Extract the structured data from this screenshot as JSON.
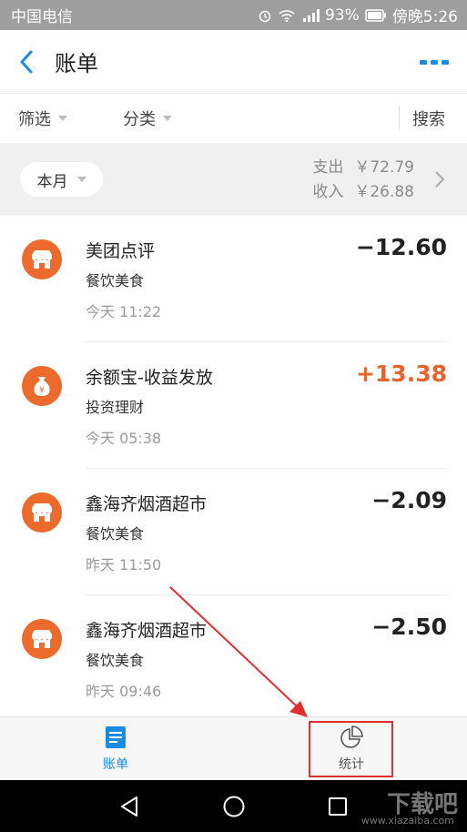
{
  "status_bar": {
    "carrier": "中国电信",
    "battery": "93%",
    "time": "傍晚5:26",
    "icons": [
      "alarm-icon",
      "wifi-icon",
      "signal-icon",
      "battery-icon"
    ]
  },
  "header": {
    "title": "账单",
    "icons": [
      "back-icon",
      "more-icon"
    ]
  },
  "filters": {
    "filter_label": "筛选",
    "category_label": "分类",
    "search_label": "搜索"
  },
  "month_bar": {
    "period": "本月",
    "expense_label": "支出",
    "expense_amount": "￥72.79",
    "income_label": "收入",
    "income_amount": "￥26.88"
  },
  "transactions": [
    {
      "name": "美团点评",
      "category": "餐饮美食",
      "time": "今天  11:22",
      "amount": "−12.60",
      "icon": "shop-icon"
    },
    {
      "name": "余额宝-收益发放",
      "category": "投资理财",
      "time": "今天  05:38",
      "amount": "+13.38",
      "icon": "money-bag-icon"
    },
    {
      "name": "鑫海齐烟酒超市",
      "category": "餐饮美食",
      "time": "昨天  11:50",
      "amount": "−2.09",
      "icon": "shop-icon"
    },
    {
      "name": "鑫海齐烟酒超市",
      "category": "餐饮美食",
      "time": "昨天  09:46",
      "amount": "−2.50",
      "icon": "shop-icon"
    }
  ],
  "tabbar": {
    "bill_label": "账单",
    "stats_label": "统计"
  },
  "watermark": {
    "text": "下载吧",
    "url": "www.xiazaiba.com"
  },
  "colors": {
    "accent": "#1a8ce6",
    "icon_orange": "#ec6a2c",
    "positive_amount": "#e8632a",
    "annotation_red": "#e12f2f"
  }
}
